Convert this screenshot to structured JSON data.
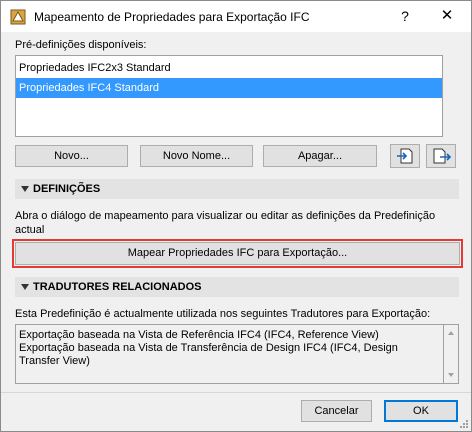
{
  "window": {
    "title": "Mapeamento de Propriedades para Exportação IFC",
    "help_label": "?",
    "close_label": "✕"
  },
  "presets": {
    "label": "Pré-definições disponíveis:",
    "items": [
      {
        "label": "Propriedades IFC2x3 Standard",
        "selected": false
      },
      {
        "label": "Propriedades IFC4 Standard",
        "selected": true
      }
    ]
  },
  "preset_buttons": {
    "new": "Novo...",
    "rename": "Novo Nome...",
    "delete": "Apagar...",
    "import_icon": "import-icon",
    "export_icon": "export-icon"
  },
  "definitions": {
    "header": "DEFINIÇÕES",
    "description_line1": "Abra o diálogo de mapeamento para visualizar ou editar as definições da Predefinição",
    "description_line2": "actual",
    "map_button": "Mapear Propriedades IFC para Exportação..."
  },
  "translators": {
    "header": "TRADUTORES RELACIONADOS",
    "description": "Esta Predefinição é actualmente utilizada nos seguintes Tradutores para Exportação:",
    "items": [
      "Exportação baseada na Vista de Referência IFC4 (IFC4, Reference View)",
      "Exportação baseada na Vista de Transferência de Design IFC4 (IFC4, Design",
      "Transfer View)"
    ]
  },
  "footer": {
    "cancel": "Cancelar",
    "ok": "OK"
  },
  "colors": {
    "selection": "#3399ff",
    "highlight_border": "#e53935",
    "default_button_border": "#0078d7"
  }
}
